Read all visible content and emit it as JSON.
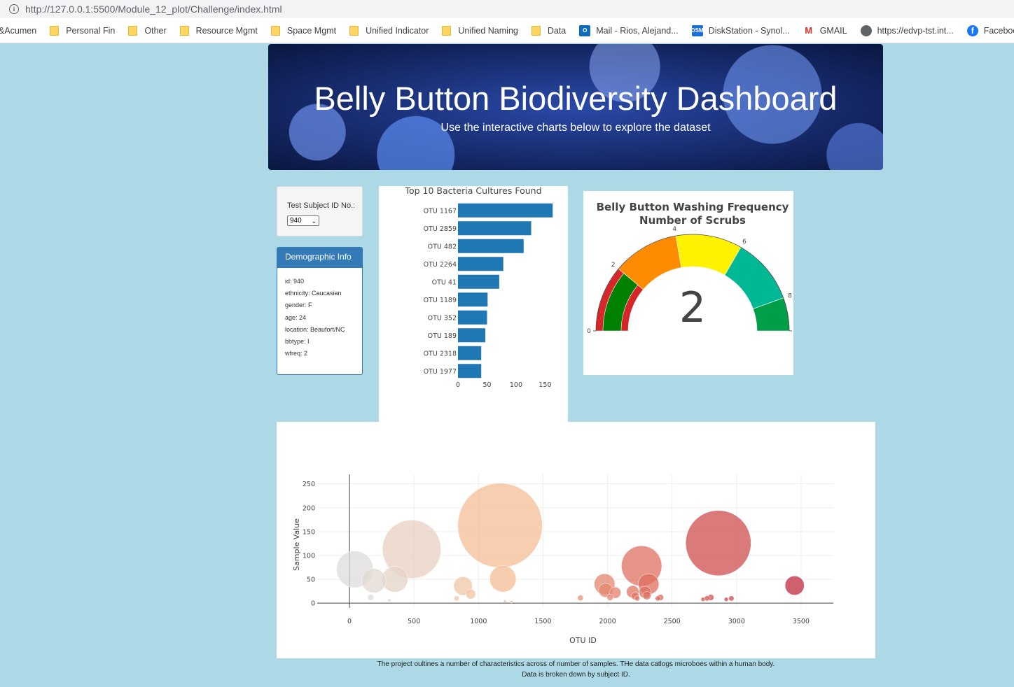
{
  "browser": {
    "url": "http://127.0.0.1:5500/Module_12_plot/Challenge/index.html",
    "bookmarks": [
      {
        "label": "&Acumen",
        "icon": "none"
      },
      {
        "label": "Personal Fin",
        "icon": "folder-icon"
      },
      {
        "label": "Other",
        "icon": "folder-icon"
      },
      {
        "label": "Resource Mgmt",
        "icon": "folder-icon"
      },
      {
        "label": "Space Mgmt",
        "icon": "folder-icon"
      },
      {
        "label": "Unified Indicator",
        "icon": "folder-icon"
      },
      {
        "label": "Unified Naming",
        "icon": "folder-icon"
      },
      {
        "label": "Data",
        "icon": "folder-icon"
      },
      {
        "label": "Mail - Rios, Alejand...",
        "icon": "outlook-icon"
      },
      {
        "label": "DiskStation - Synol...",
        "icon": "dsm-icon"
      },
      {
        "label": "GMAIL",
        "icon": "gmail-icon"
      },
      {
        "label": "https://edvp-tst.int...",
        "icon": "globe-icon"
      },
      {
        "label": "Facebook",
        "icon": "facebook-icon"
      }
    ]
  },
  "header": {
    "title": "Belly Button Biodiversity Dashboard",
    "subtitle": "Use the interactive charts below to explore the dataset"
  },
  "selector": {
    "label": "Test Subject ID No.:",
    "value": "940"
  },
  "demographics": {
    "heading": "Demographic Info",
    "rows": [
      "id: 940",
      "ethnicity: Caucasian",
      "gender: F",
      "age: 24",
      "location: Beaufort/NC",
      "bbtype: I",
      "wfreq: 2"
    ]
  },
  "colors": {
    "bar": "#1f77b4",
    "panel_primary": "#337ab7",
    "background": "#add8e6"
  },
  "chart_data": [
    {
      "type": "bar",
      "orientation": "horizontal",
      "title": "Top 10 Bacteria Cultures Found",
      "categories": [
        "OTU 1167",
        "OTU 2859",
        "OTU 482",
        "OTU 2264",
        "OTU 41",
        "OTU 1189",
        "OTU 352",
        "OTU 189",
        "OTU 2318",
        "OTU 1977"
      ],
      "values": [
        163,
        126,
        113,
        78,
        71,
        51,
        50,
        47,
        40,
        40
      ],
      "xticks": [
        "0",
        "50",
        "100",
        "150"
      ],
      "xlim": [
        0,
        175
      ]
    },
    {
      "type": "gauge",
      "title_line1": "Belly Button Washing Frequency",
      "title_line2": "Number of Scrubs",
      "value": 2,
      "range": [
        0,
        9
      ],
      "ticks": [
        "0",
        "2",
        "4",
        "6",
        "8"
      ],
      "steps": [
        {
          "range": [
            0,
            2
          ],
          "color": "#d62728"
        },
        {
          "range": [
            2,
            4
          ],
          "color": "#ff8c00"
        },
        {
          "range": [
            4,
            6
          ],
          "color": "#fff200"
        },
        {
          "range": [
            6,
            8
          ],
          "color": "#00b894"
        },
        {
          "range": [
            8,
            9
          ],
          "color": "#009e49"
        }
      ],
      "bar_color": "#008000"
    },
    {
      "type": "scatter",
      "xlabel": "OTU ID",
      "ylabel": "Sample Value",
      "xlim": [
        -250,
        3750
      ],
      "ylim": [
        -10,
        270
      ],
      "xticks": [
        "0",
        "500",
        "1000",
        "1500",
        "2000",
        "2500",
        "3000",
        "3500"
      ],
      "yticks": [
        "0",
        "50",
        "100",
        "150",
        "200",
        "250"
      ],
      "points": [
        {
          "x": 41,
          "y": 71
        },
        {
          "x": 189,
          "y": 47
        },
        {
          "x": 352,
          "y": 50
        },
        {
          "x": 482,
          "y": 113
        },
        {
          "x": 1167,
          "y": 163
        },
        {
          "x": 1189,
          "y": 51
        },
        {
          "x": 2859,
          "y": 126
        },
        {
          "x": 2264,
          "y": 78
        },
        {
          "x": 1977,
          "y": 40
        },
        {
          "x": 2318,
          "y": 40
        },
        {
          "x": 3450,
          "y": 37
        },
        {
          "x": 880,
          "y": 36
        },
        {
          "x": 940,
          "y": 19
        },
        {
          "x": 1985,
          "y": 27
        },
        {
          "x": 2060,
          "y": 22
        },
        {
          "x": 2195,
          "y": 24
        },
        {
          "x": 2215,
          "y": 15
        },
        {
          "x": 2290,
          "y": 23
        },
        {
          "x": 2305,
          "y": 16
        },
        {
          "x": 2020,
          "y": 12
        },
        {
          "x": 2230,
          "y": 10
        },
        {
          "x": 2390,
          "y": 10
        },
        {
          "x": 2410,
          "y": 12
        },
        {
          "x": 2770,
          "y": 10
        },
        {
          "x": 2800,
          "y": 12
        },
        {
          "x": 2740,
          "y": 8
        },
        {
          "x": 2920,
          "y": 8
        },
        {
          "x": 2960,
          "y": 10
        },
        {
          "x": 165,
          "y": 12
        },
        {
          "x": 310,
          "y": 6
        },
        {
          "x": 830,
          "y": 10
        },
        {
          "x": 1205,
          "y": 4
        },
        {
          "x": 1255,
          "y": 3
        },
        {
          "x": 1790,
          "y": 11
        }
      ]
    }
  ],
  "footer": {
    "line1": "The project oultines a number of characteristics across of number of samples. THe data catlogs microboes within a human body.",
    "line2": "Data is broken down by subject ID."
  }
}
